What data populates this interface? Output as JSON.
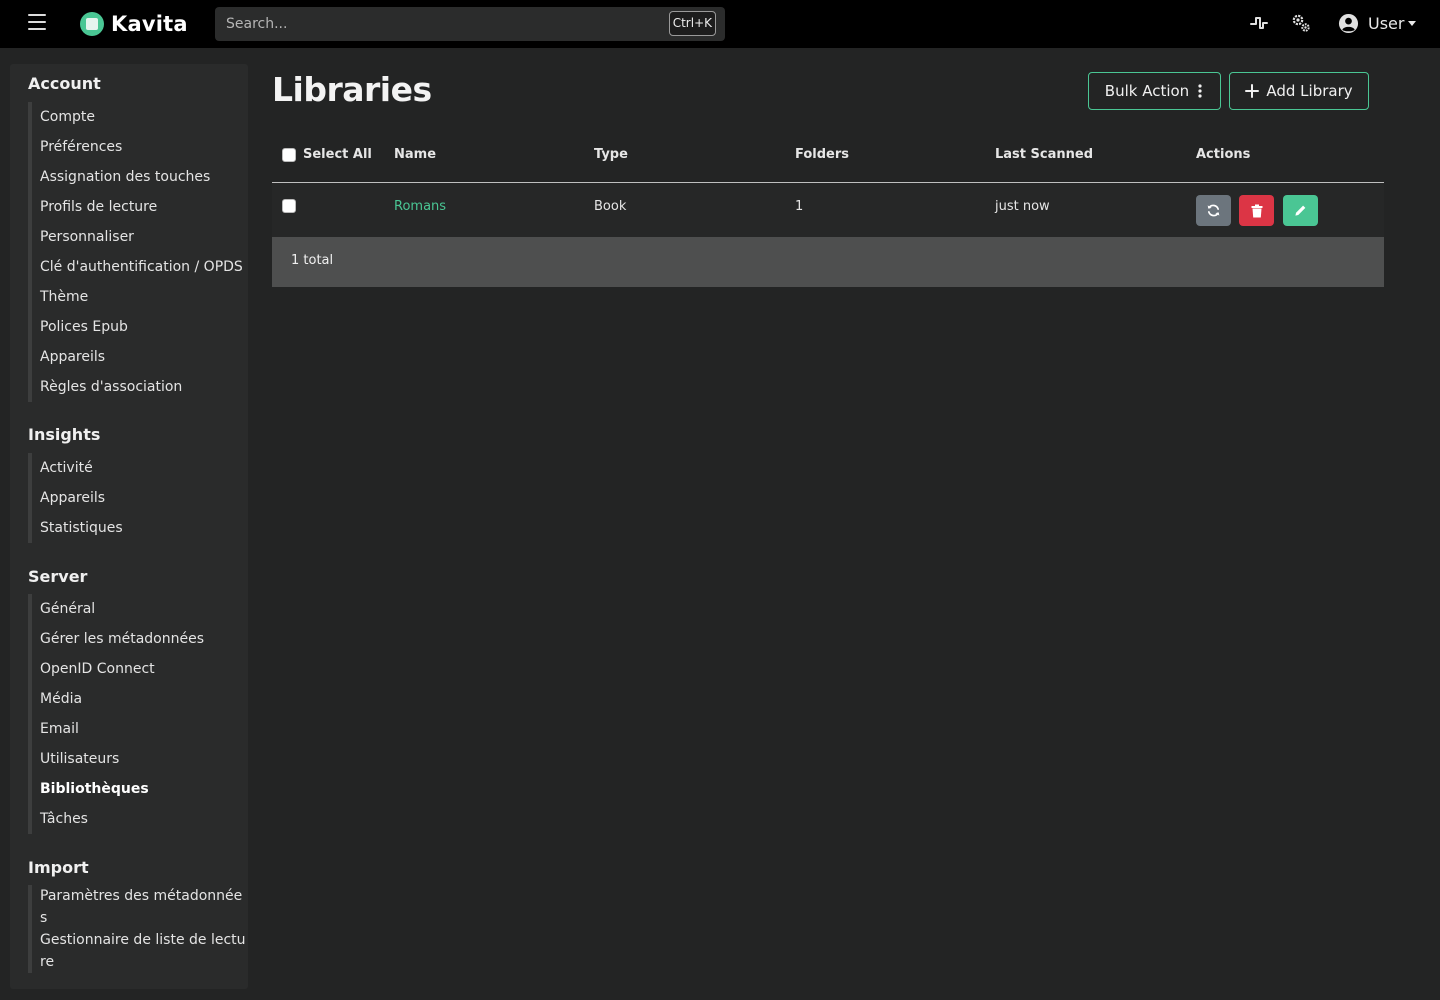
{
  "header": {
    "app_name": "Kavita",
    "search_placeholder": "Search...",
    "search_shortcut": "Ctrl+K",
    "user_label": "User"
  },
  "sidebar": {
    "account": {
      "title": "Account",
      "items": [
        "Compte",
        "Préférences",
        "Assignation des touches",
        "Profils de lecture",
        "Personnaliser",
        "Clé d'authentification / OPDS",
        "Thème",
        "Polices Epub",
        "Appareils",
        "Règles d'association"
      ]
    },
    "insights": {
      "title": "Insights",
      "items": [
        "Activité",
        "Appareils",
        "Statistiques"
      ]
    },
    "server": {
      "title": "Server",
      "items": [
        "Général",
        "Gérer les métadonnées",
        "OpenID Connect",
        "Média",
        "Email",
        "Utilisateurs",
        "Bibliothèques",
        "Tâches"
      ],
      "active": "Bibliothèques"
    },
    "import": {
      "title": "Import",
      "items": [
        "Paramètres des métadonnées",
        "Gestionnaire de liste de lecture"
      ]
    }
  },
  "main": {
    "title": "Libraries",
    "bulk_action_label": "Bulk Action",
    "add_library_label": "Add Library",
    "table": {
      "columns": [
        "Select All",
        "Name",
        "Type",
        "Folders",
        "Last Scanned",
        "Actions"
      ],
      "rows": [
        {
          "name": "Romans",
          "type": "Book",
          "folders": "1",
          "last_scanned": "just now"
        }
      ],
      "footer": "1 total"
    }
  },
  "colors": {
    "accent": "#4ac694",
    "danger": "#dc3545",
    "scan_button": "#6c757d",
    "edit_button": "#4ac694"
  }
}
